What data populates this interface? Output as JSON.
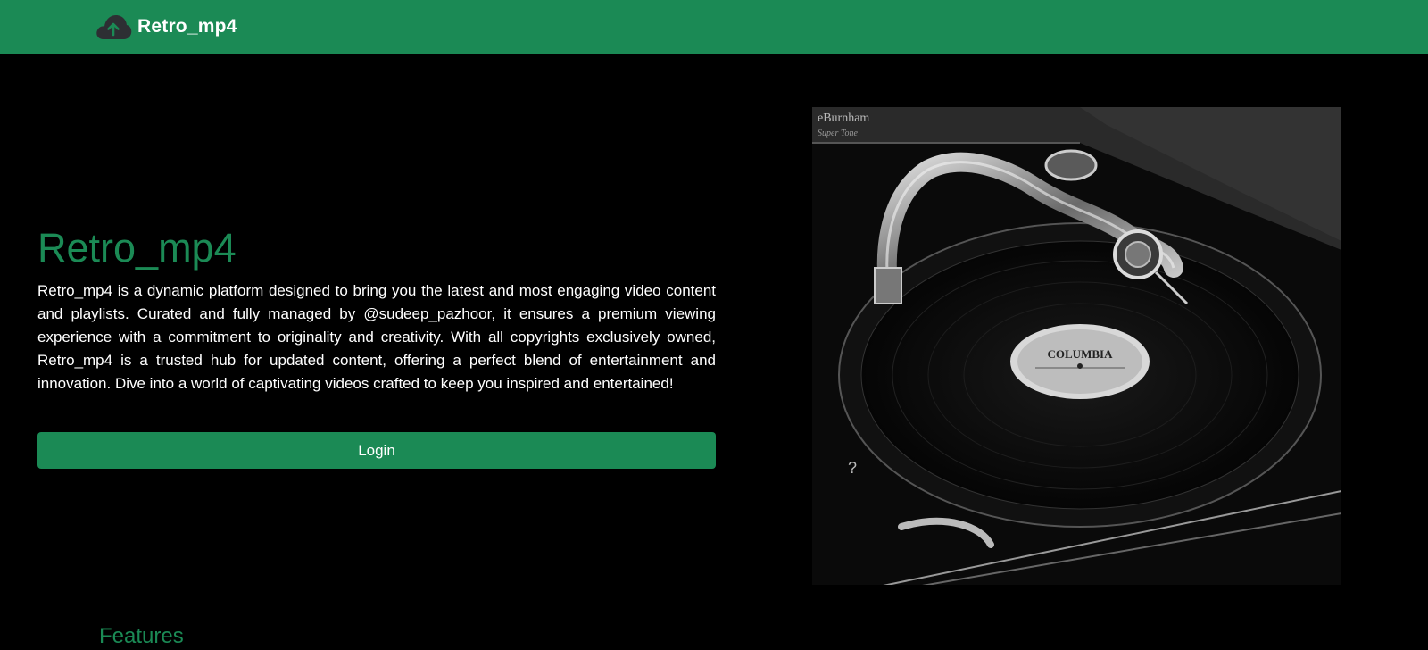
{
  "navbar": {
    "brand_icon": "cloud-upload-icon",
    "brand_text": "Retro_mp4",
    "bg_color": "#1b8a55"
  },
  "hero": {
    "title": "Retro_mp4",
    "description": "Retro_mp4 is a dynamic platform designed to bring you the latest and most engaging video content and playlists. Curated and fully managed by @sudeep_pazhoor, it ensures a premium viewing experience with a commitment to originality and creativity. With all copyrights exclusively owned, Retro_mp4 is a trusted hub for updated content, offering a perfect blend of entertainment and innovation. Dive into a world of captivating videos crafted to keep you inspired and entertained!",
    "login_label": "Login",
    "image_subject": "black-and-white gramophone turntable with Columbia record",
    "image_label_text": "COLUMBIA",
    "image_brand_text": "eBurnham",
    "image_brand_subtext": "Super Tone"
  },
  "features": {
    "heading": "Features"
  },
  "colors": {
    "accent": "#1b8a55",
    "background": "#000000",
    "text": "#ffffff"
  }
}
